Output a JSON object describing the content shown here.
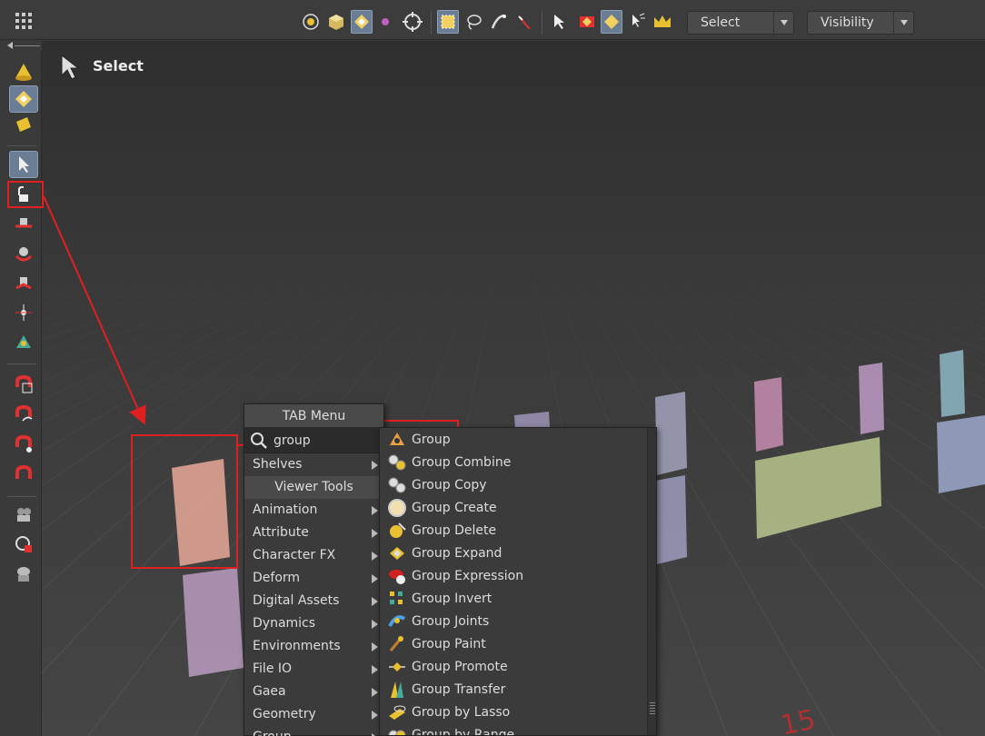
{
  "toolbar": {
    "select_dropdown": "Select",
    "visibility_dropdown": "Visibility"
  },
  "viewport": {
    "mode_label": "Select",
    "floor_number": "15"
  },
  "tab_menu": {
    "title": "TAB Menu",
    "search_value": "group",
    "items": [
      {
        "label": "Shelves",
        "submenu": true
      },
      {
        "label": "Viewer Tools",
        "section": true
      },
      {
        "label": "Animation",
        "submenu": true
      },
      {
        "label": "Attribute",
        "submenu": true
      },
      {
        "label": "Character FX",
        "submenu": true
      },
      {
        "label": "Deform",
        "submenu": true
      },
      {
        "label": "Digital Assets",
        "submenu": true
      },
      {
        "label": "Dynamics",
        "submenu": true
      },
      {
        "label": "Environments",
        "submenu": true
      },
      {
        "label": "File IO",
        "submenu": true
      },
      {
        "label": "Gaea",
        "submenu": true
      },
      {
        "label": "Geometry",
        "submenu": true
      },
      {
        "label": "Group",
        "submenu": true
      }
    ]
  },
  "group_submenu": {
    "items": [
      {
        "label": "Group",
        "icon": "group-icon"
      },
      {
        "label": "Group Combine",
        "icon": "group-combine-icon"
      },
      {
        "label": "Group Copy",
        "icon": "group-copy-icon"
      },
      {
        "label": "Group Create",
        "icon": "group-create-icon"
      },
      {
        "label": "Group Delete",
        "icon": "group-delete-icon"
      },
      {
        "label": "Group Expand",
        "icon": "group-expand-icon"
      },
      {
        "label": "Group Expression",
        "icon": "group-expression-icon"
      },
      {
        "label": "Group Invert",
        "icon": "group-invert-icon"
      },
      {
        "label": "Group Joints",
        "icon": "group-joints-icon"
      },
      {
        "label": "Group Paint",
        "icon": "group-paint-icon"
      },
      {
        "label": "Group Promote",
        "icon": "group-promote-icon"
      },
      {
        "label": "Group Transfer",
        "icon": "group-transfer-icon"
      },
      {
        "label": "Group by Lasso",
        "icon": "group-by-lasso-icon"
      },
      {
        "label": "Group by Range",
        "icon": "group-by-range-icon"
      }
    ]
  },
  "colors": {
    "highlight_red": "#e02020",
    "active_button": "#6b7d95"
  }
}
